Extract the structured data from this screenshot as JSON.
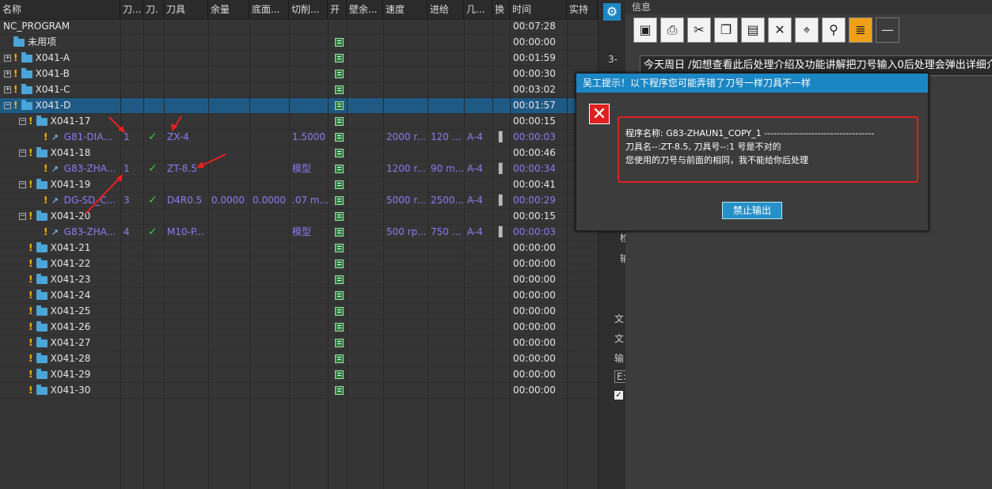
{
  "columns": [
    "名称",
    "刀...",
    "刀.",
    "刀具",
    "余量",
    "底面...",
    "切削...",
    "开",
    "壁余...",
    "速度",
    "进给",
    "几...",
    "换",
    "时间",
    "实持"
  ],
  "root": {
    "name": "NC_PROGRAM",
    "time": "00:07:28"
  },
  "rows": [
    {
      "name": "未用项",
      "time": "00:00:00"
    },
    {
      "name": "X041-A",
      "time": "00:01:59"
    },
    {
      "name": "X041-B",
      "time": "00:00:30"
    },
    {
      "name": "X041-C",
      "time": "00:03:02"
    },
    {
      "name": "X041-D",
      "time": "00:01:57"
    },
    {
      "name": "X041-17",
      "time": "00:00:15"
    },
    {
      "name": "G81-DIA...",
      "tool_no": "1",
      "tool": "ZX-4",
      "cut": "1.5000",
      "speed": "2000 r...",
      "feed": "120 ...",
      "geo": "A-4",
      "time": "00:00:03"
    },
    {
      "name": "X041-18",
      "time": "00:00:46"
    },
    {
      "name": "G83-ZHA...",
      "tool_no": "1",
      "tool": "ZT-8.5",
      "cut": "模型",
      "speed": "1200 r...",
      "feed": "90 m...",
      "geo": "A-4",
      "time": "00:00:34"
    },
    {
      "name": "X041-19",
      "time": "00:00:41"
    },
    {
      "name": "DG-SD_C...",
      "tool_no": "3",
      "tool": "D4R0.5",
      "stock": "0.0000",
      "floor": "0.0000",
      "cut": ".07 m...",
      "speed": "5000 r...",
      "feed": "2500...",
      "geo": "A-4",
      "time": "00:00:29"
    },
    {
      "name": "X041-20",
      "time": "00:00:15"
    },
    {
      "name": "G83-ZHA...",
      "tool_no": "4",
      "tool": "M10-P...",
      "cut": "模型",
      "speed": "500 rp...",
      "feed": "750 ...",
      "geo": "A-4",
      "time": "00:00:03"
    },
    {
      "name": "X041-21",
      "time": "00:00:00"
    },
    {
      "name": "X041-22",
      "time": "00:00:00"
    },
    {
      "name": "X041-23",
      "time": "00:00:00"
    },
    {
      "name": "X041-24",
      "time": "00:00:00"
    },
    {
      "name": "X041-25",
      "time": "00:00:00"
    },
    {
      "name": "X041-26",
      "time": "00:00:00"
    },
    {
      "name": "X041-27",
      "time": "00:00:00"
    },
    {
      "name": "X041-28",
      "time": "00:00:00"
    },
    {
      "name": "X041-29",
      "time": "00:00:00"
    },
    {
      "name": "X041-30",
      "time": "00:00:00"
    }
  ],
  "info_panel": {
    "title": "信息",
    "notice": "今天周日 /如想查看此后处理介绍及功能讲解把刀号输入0后处理会弹出详细介"
  },
  "side_labels": [
    "3-",
    "检",
    "输",
    "文",
    "文",
    "输",
    "E:"
  ],
  "dialog": {
    "title": "吴工提示！以下程序您可能弄错了刀号一样刀具不一样",
    "line1": "程序名称:  G83-ZHAUN1_COPY_1 -----------------------------------",
    "line2": "刀具名--:ZT-8.5,          刀具号--:1  号是不对的",
    "line3": "您使用的刀号与前面的相同，我不能给你后处理",
    "button": "禁止输出"
  },
  "colors": {
    "accent": "#1b86c4",
    "error": "#e02020",
    "check": "#2ecc40",
    "op_text": "#8a7cf0"
  }
}
